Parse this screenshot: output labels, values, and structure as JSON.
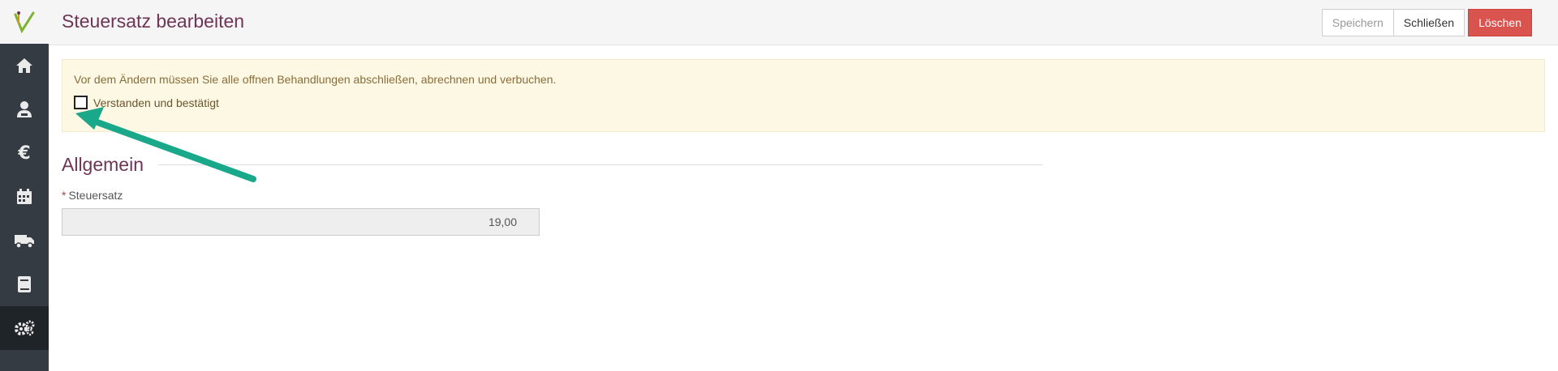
{
  "sidebar": {
    "items": [
      {
        "icon": "home-icon"
      },
      {
        "icon": "patient-icon"
      },
      {
        "icon": "euro-icon"
      },
      {
        "icon": "calendar-icon"
      },
      {
        "icon": "truck-icon"
      },
      {
        "icon": "book-icon"
      },
      {
        "icon": "settings-icon",
        "active": true
      }
    ]
  },
  "header": {
    "title": "Steuersatz bearbeiten",
    "save_label": "Speichern",
    "close_label": "Schließen",
    "delete_label": "Löschen"
  },
  "alert": {
    "text": "Vor dem Ändern müssen Sie alle offnen Behandlungen abschließen, abrechnen und verbuchen.",
    "checkbox_label": "Verstanden und bestätigt",
    "checkbox_checked": false
  },
  "section": {
    "title": "Allgemein"
  },
  "form": {
    "required_marker": "*",
    "tax_rate_label": "Steuersatz",
    "tax_rate_value": "19,00"
  },
  "colors": {
    "accent": "#6e3556",
    "sidebar": "#353b42",
    "danger": "#d9534f",
    "alert_bg": "#fcf8e3",
    "arrow": "#1aa88a"
  }
}
